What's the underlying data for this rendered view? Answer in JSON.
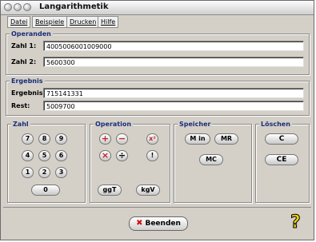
{
  "window": {
    "title": "Langarithmetik"
  },
  "menu": [
    "Datei",
    "Beispiele",
    "Drucken",
    "Hilfe"
  ],
  "operanden": {
    "legend": "Operanden",
    "zahl1_label": "Zahl 1:",
    "zahl1_value": "4005006001009000",
    "zahl2_label": "Zahl 2:",
    "zahl2_value": "5600300"
  },
  "ergebnis": {
    "legend": "Ergebnis",
    "ergebnis_label": "Ergebnis:",
    "ergebnis_value": "715141331",
    "rest_label": "Rest:",
    "rest_value": "5009700"
  },
  "zahl": {
    "legend": "Zahl",
    "keys": [
      "7",
      "8",
      "9",
      "4",
      "5",
      "6",
      "1",
      "2",
      "3",
      "0"
    ]
  },
  "operation": {
    "legend": "Operation",
    "plus": "+",
    "minus": "−",
    "power": "x²",
    "times": "×",
    "divide": "÷",
    "fact": "!",
    "ggt": "ggT",
    "kgv": "kgV"
  },
  "speicher": {
    "legend": "Speicher",
    "min": "M in",
    "mr": "MR",
    "mc": "MC"
  },
  "loeschen": {
    "legend": "Löschen",
    "c": "C",
    "ce": "CE"
  },
  "footer": {
    "beenden": "Beenden"
  }
}
